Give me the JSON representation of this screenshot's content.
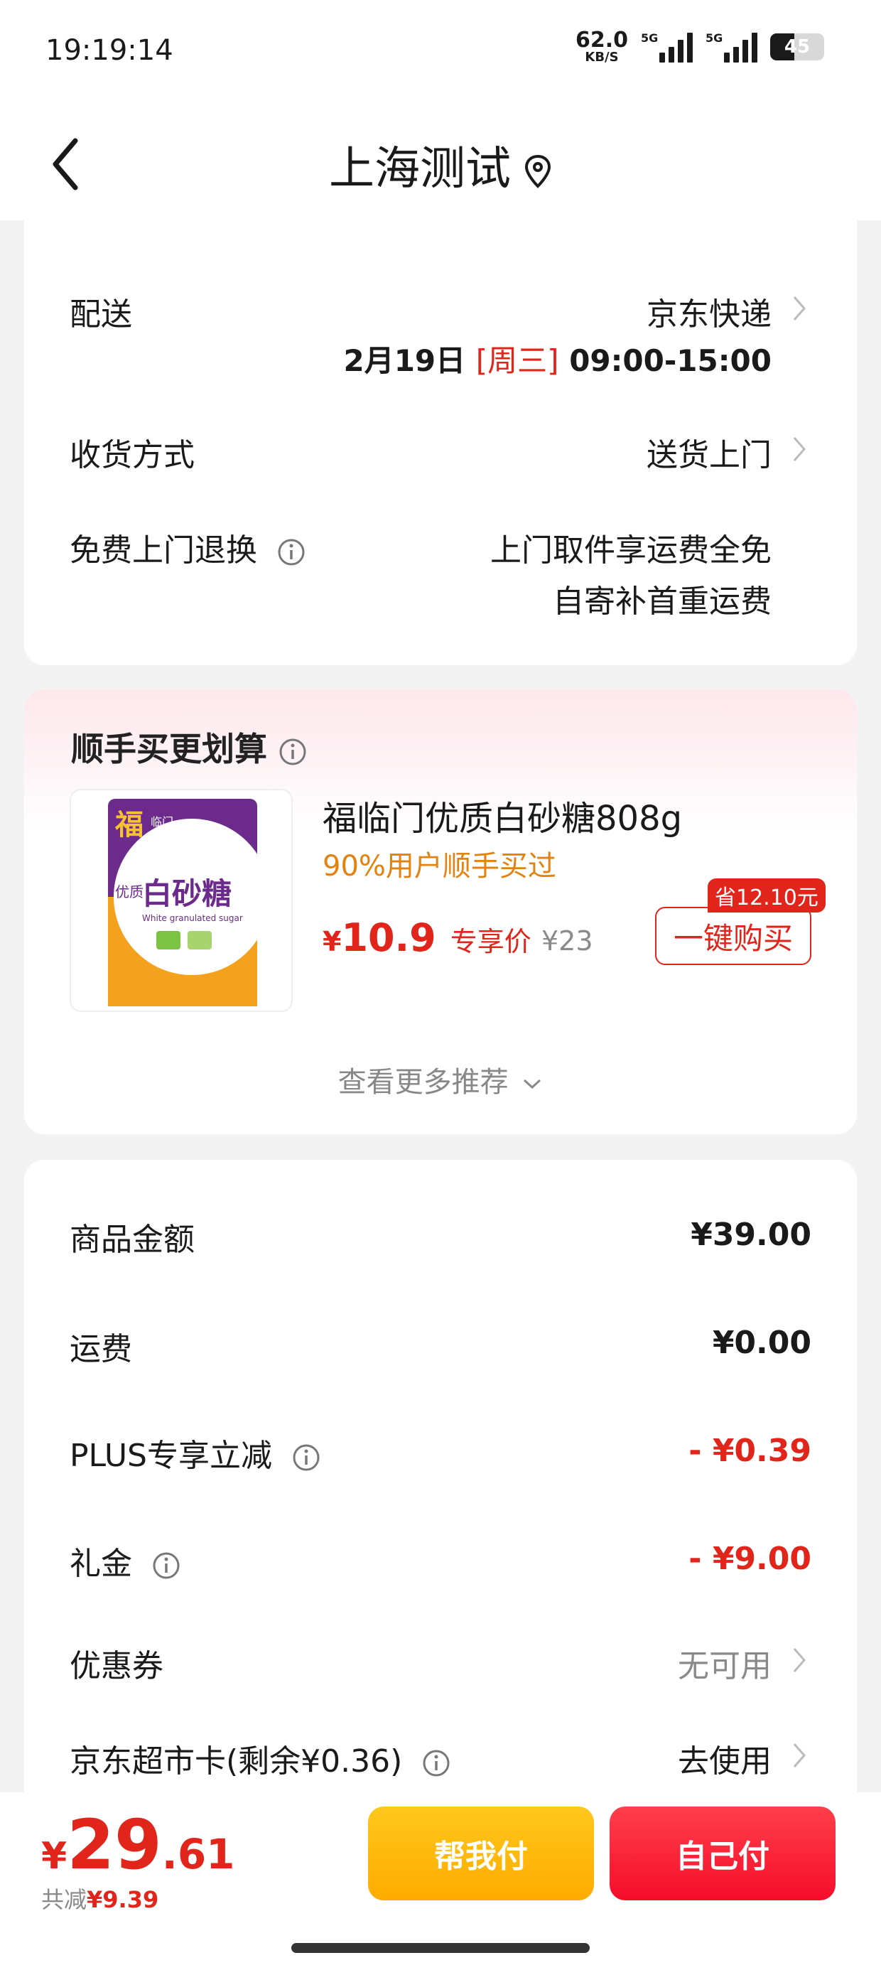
{
  "status_bar": {
    "time": "19:19:14",
    "net_speed": "62.0",
    "net_unit": "KB/S",
    "signal1_label": "5G",
    "signal2_label": "5G",
    "battery": "45",
    "battery_level": 0.45
  },
  "header": {
    "title": "上海测试",
    "back_icon": "chevron-left-icon",
    "location_icon": "location-pin-icon"
  },
  "delivery": {
    "label": "配送",
    "carrier": "京东快递",
    "date": "2月19日",
    "weekday": "[周三]",
    "time_window": "09:00-15:00",
    "receive_label": "收货方式",
    "receive_value": "送货上门",
    "return_label": "免费上门退换",
    "return_line1": "上门取件享运费全免",
    "return_line2": "自寄补首重运费"
  },
  "upsell": {
    "title": "顺手买更划算",
    "product_name": "福临门优质白砂糖808g",
    "product_note": "90%用户顺手买过",
    "currency": "¥",
    "price": "10.9",
    "price_tag": "专享价",
    "original_price": "¥23",
    "save_tag": "省12.10元",
    "buy_label": "一键购买",
    "more_label": "查看更多推荐",
    "image_brand": "福",
    "image_logo": "临门",
    "image_text": "白砂糖",
    "image_side": "优质",
    "image_sub": "White granulated sugar"
  },
  "summary": {
    "rows": [
      {
        "label": "商品金额",
        "value": "¥39.00"
      },
      {
        "label": "运费",
        "value": "¥0.00"
      },
      {
        "label": "PLUS专享立减",
        "value": "- ¥0.39"
      },
      {
        "label": "礼金",
        "value": "- ¥9.00"
      },
      {
        "label": "优惠券",
        "value": "无可用"
      },
      {
        "label": "京东超市卡(剩余¥0.36)",
        "value": "去使用"
      }
    ]
  },
  "bottom": {
    "currency": "¥",
    "total_int": "29",
    "total_dec": ".61",
    "discount_label": "共减",
    "discount_value": "¥9.39",
    "help_pay": "帮我付",
    "self_pay": "自己付"
  },
  "colors": {
    "accent_red": "#e1251b",
    "orange_note": "#e48210",
    "yellow_button": "#ffb800",
    "red_button": "#f5152f"
  }
}
